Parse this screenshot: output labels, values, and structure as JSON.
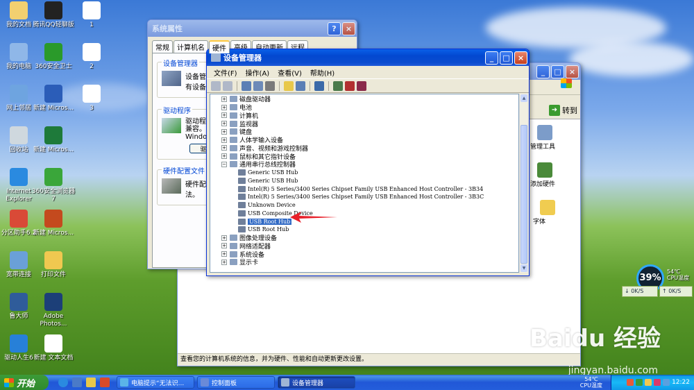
{
  "desktop": {
    "icons": [
      {
        "label": "我的文档",
        "color": "#f2d070"
      },
      {
        "label": "我的电脑",
        "color": "#8fb7e8"
      },
      {
        "label": "网上邻居",
        "color": "#6ea4e0"
      },
      {
        "label": "回收站",
        "color": "#cfd8de"
      },
      {
        "label": "Internet Explorer",
        "color": "#2a8ae0"
      },
      {
        "label": "分区助手6.2",
        "color": "#d94a37"
      },
      {
        "label": "宽带连接",
        "color": "#6aa0d8"
      },
      {
        "label": "鲁大师",
        "color": "#2f5c9a"
      },
      {
        "label": "驱动人生6",
        "color": "#2780d8"
      },
      {
        "label": "腾讯QQ轻聊版",
        "color": "#222222"
      },
      {
        "label": "360安全卫士",
        "color": "#2a9a2a"
      },
      {
        "label": "新建 Micros...",
        "color": "#2b5db8"
      },
      {
        "label": "新建 Micros...",
        "color": "#1e7a3a"
      },
      {
        "label": "360安全浏览器7",
        "color": "#3aa63a"
      },
      {
        "label": "新建 Micros...",
        "color": "#c44a1e"
      },
      {
        "label": "打印文件",
        "color": "#f0c850"
      },
      {
        "label": "Adobe Photos...",
        "color": "#1c3f78"
      },
      {
        "label": "新建 文本文档",
        "color": "#ffffff"
      },
      {
        "label": "1",
        "color": "#ffffff"
      },
      {
        "label": "2",
        "color": "#ffffff"
      },
      {
        "label": "3",
        "color": "#ffffff"
      }
    ]
  },
  "system_properties": {
    "title": "系统属性",
    "tabs": [
      "常规",
      "计算机名",
      "硬件",
      "高级",
      "自动更新",
      "远程"
    ],
    "active_tab": "硬件",
    "groups": [
      {
        "legend": "设备管理器",
        "text": "设备管\n有设备"
      },
      {
        "legend": "驱动程序",
        "text": "驱动程\n兼容。\nWindow",
        "button": "驱"
      },
      {
        "legend": "硬件配置文件",
        "text": "硬件配\n法。"
      }
    ]
  },
  "control_panel": {
    "go_label": "转到",
    "items": [
      "管理工具",
      "添加硬件",
      "字体"
    ],
    "status": "查看您的计算机系统的信息，并为硬件、性能和自动更新更改设置。"
  },
  "device_manager": {
    "title": "设备管理器",
    "menu": [
      "文件(F)",
      "操作(A)",
      "查看(V)",
      "帮助(H)"
    ],
    "tree": [
      {
        "label": "磁盘驱动器",
        "level": 0,
        "expander": "+"
      },
      {
        "label": "电池",
        "level": 0,
        "expander": "+"
      },
      {
        "label": "计算机",
        "level": 0,
        "expander": "+"
      },
      {
        "label": "监视器",
        "level": 0,
        "expander": "+"
      },
      {
        "label": "键盘",
        "level": 0,
        "expander": "+"
      },
      {
        "label": "人体学输入设备",
        "level": 0,
        "expander": "+"
      },
      {
        "label": "声音、视频和游戏控制器",
        "level": 0,
        "expander": "+"
      },
      {
        "label": "鼠标和其它指针设备",
        "level": 0,
        "expander": "+"
      },
      {
        "label": "通用串行总线控制器",
        "level": 0,
        "expander": "-"
      },
      {
        "label": "Generic USB Hub",
        "level": 1
      },
      {
        "label": "Generic USB Hub",
        "level": 1
      },
      {
        "label": "Intel(R) 5 Series/3400 Series Chipset Family USB Enhanced Host Controller - 3B34",
        "level": 1
      },
      {
        "label": "Intel(R) 5 Series/3400 Series Chipset Family USB Enhanced Host Controller - 3B3C",
        "level": 1
      },
      {
        "label": "Unknown Device",
        "level": 1
      },
      {
        "label": "USB Composite Device",
        "level": 1
      },
      {
        "label": "USB Root Hub",
        "level": 1,
        "selected": true
      },
      {
        "label": "USB Root Hub",
        "level": 1
      },
      {
        "label": "图像处理设备",
        "level": 0,
        "expander": "+"
      },
      {
        "label": "网络适配器",
        "level": 0,
        "expander": "+"
      },
      {
        "label": "系统设备",
        "level": 0,
        "expander": "+"
      },
      {
        "label": "显示卡",
        "level": 0,
        "expander": "+"
      }
    ]
  },
  "widget": {
    "cpu_percent": "39%",
    "temp": "54℃",
    "temp_label": "CPU温度",
    "net_down": "0K/S",
    "net_up": "0K/S"
  },
  "watermark": {
    "brand": "Baidu 经验",
    "url": "jingyan.baidu.com"
  },
  "taskbar": {
    "start_label": "开始",
    "tasks": [
      {
        "label": "电脑提示“无法识...",
        "active": false
      },
      {
        "label": "控制面板",
        "active": false
      },
      {
        "label": "设备管理器",
        "active": true
      }
    ],
    "tray_temp": "54℃",
    "tray_temp_label": "CPU温度",
    "clock": "12:22"
  },
  "colors": {
    "xp_blue": "#0a5fe8",
    "selection": "#316ac5",
    "arrow_red": "#e8202a",
    "start_green": "#3c9b38"
  }
}
